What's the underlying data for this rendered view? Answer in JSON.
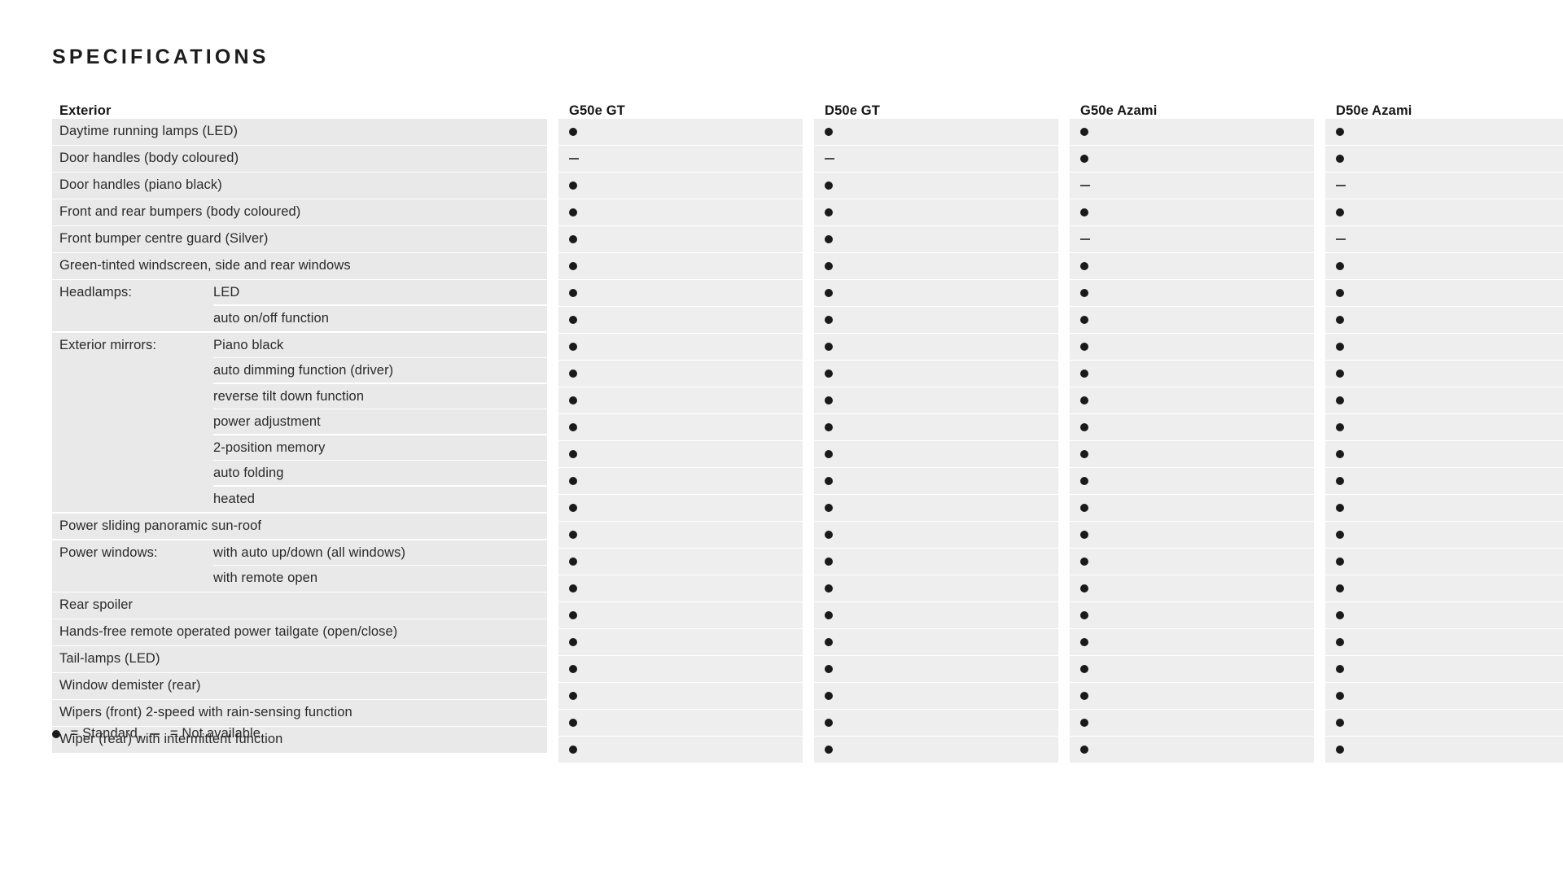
{
  "page": {
    "title": "SPECIFICATIONS"
  },
  "table": {
    "section_header": "Exterior",
    "columns": [
      {
        "label": "G50e GT"
      },
      {
        "label": "D50e GT"
      },
      {
        "label": "G50e Azami"
      },
      {
        "label": "D50e Azami"
      }
    ],
    "rows": [
      {
        "type": "single",
        "label": "Daytime running lamps (LED)",
        "marks": [
          "dot",
          "dot",
          "dot",
          "dot"
        ]
      },
      {
        "type": "single",
        "label": "Door handles (body coloured)",
        "marks": [
          "dash",
          "dash",
          "dot",
          "dot"
        ]
      },
      {
        "type": "single",
        "label": "Door handles (piano black)",
        "marks": [
          "dot",
          "dot",
          "dash",
          "dash"
        ]
      },
      {
        "type": "single",
        "label": "Front and rear bumpers (body coloured)",
        "marks": [
          "dot",
          "dot",
          "dot",
          "dot"
        ]
      },
      {
        "type": "single",
        "label": "Front bumper centre guard (Silver)",
        "marks": [
          "dot",
          "dot",
          "dash",
          "dash"
        ]
      },
      {
        "type": "single",
        "label": "Green-tinted windscreen, side and rear windows",
        "marks": [
          "dot",
          "dot",
          "dot",
          "dot"
        ]
      },
      {
        "type": "group",
        "label": "Headlamps:",
        "sub": "LED",
        "marks": [
          "dot",
          "dot",
          "dot",
          "dot"
        ]
      },
      {
        "type": "groupcont",
        "label": "",
        "sub": "auto on/off function",
        "marks": [
          "dot",
          "dot",
          "dot",
          "dot"
        ]
      },
      {
        "type": "group",
        "label": "Exterior mirrors:",
        "sub": "Piano black",
        "marks": [
          "dot",
          "dot",
          "dot",
          "dot"
        ]
      },
      {
        "type": "groupcont",
        "label": "",
        "sub": "auto dimming function (driver)",
        "marks": [
          "dot",
          "dot",
          "dot",
          "dot"
        ]
      },
      {
        "type": "groupcont",
        "label": "",
        "sub": "reverse tilt down function",
        "marks": [
          "dot",
          "dot",
          "dot",
          "dot"
        ]
      },
      {
        "type": "groupcont",
        "label": "",
        "sub": "power adjustment",
        "marks": [
          "dot",
          "dot",
          "dot",
          "dot"
        ]
      },
      {
        "type": "groupcont",
        "label": "",
        "sub": "2-position memory",
        "marks": [
          "dot",
          "dot",
          "dot",
          "dot"
        ]
      },
      {
        "type": "groupcont",
        "label": "",
        "sub": "auto folding",
        "marks": [
          "dot",
          "dot",
          "dot",
          "dot"
        ]
      },
      {
        "type": "groupcont",
        "label": "",
        "sub": "heated",
        "marks": [
          "dot",
          "dot",
          "dot",
          "dot"
        ]
      },
      {
        "type": "single",
        "label": "Power sliding panoramic sun-roof",
        "marks": [
          "dot",
          "dot",
          "dot",
          "dot"
        ]
      },
      {
        "type": "group",
        "label": "Power windows:",
        "sub": "with auto up/down (all windows)",
        "marks": [
          "dot",
          "dot",
          "dot",
          "dot"
        ]
      },
      {
        "type": "groupcont",
        "label": "",
        "sub": "with remote open",
        "marks": [
          "dot",
          "dot",
          "dot",
          "dot"
        ]
      },
      {
        "type": "single",
        "label": "Rear spoiler",
        "marks": [
          "dot",
          "dot",
          "dot",
          "dot"
        ]
      },
      {
        "type": "single",
        "label": "Hands-free remote operated power tailgate (open/close)",
        "marks": [
          "dot",
          "dot",
          "dot",
          "dot"
        ]
      },
      {
        "type": "single",
        "label": "Tail-lamps (LED)",
        "marks": [
          "dot",
          "dot",
          "dot",
          "dot"
        ]
      },
      {
        "type": "single",
        "label": "Window demister (rear)",
        "marks": [
          "dot",
          "dot",
          "dot",
          "dot"
        ]
      },
      {
        "type": "single",
        "label": "Wipers (front) 2-speed with rain-sensing function",
        "marks": [
          "dot",
          "dot",
          "dot",
          "dot"
        ]
      },
      {
        "type": "single",
        "label": "Wiper (rear) with intermittent function",
        "marks": [
          "dot",
          "dot",
          "dot",
          "dot"
        ]
      }
    ]
  },
  "legend": {
    "standard_text": " = Standard, ",
    "not_available_text": " = Not available."
  },
  "colors": {
    "row_background": "#e9e9e9",
    "mark_background": "#eeeeee",
    "text": "#2a2a2a",
    "title": "#1d1d1d",
    "dot": "#1a1a1a",
    "dash": "#4a4a4a",
    "page_background": "#ffffff"
  }
}
